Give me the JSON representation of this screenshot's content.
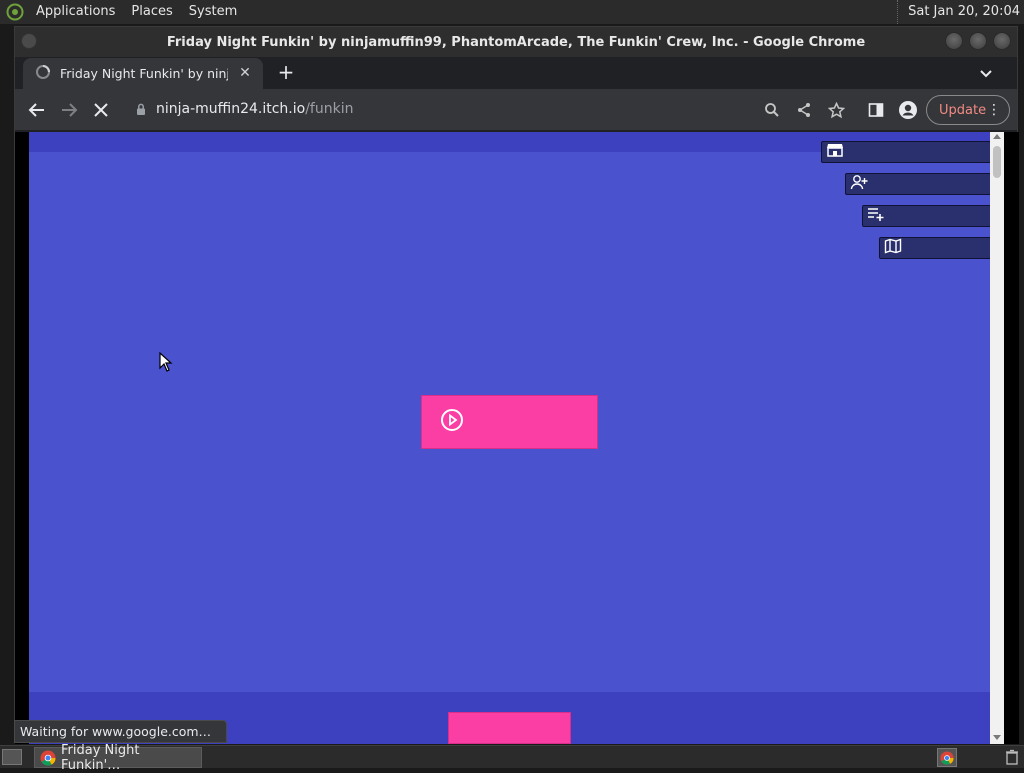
{
  "top_panel": {
    "menus": [
      "Applications",
      "Places",
      "System"
    ],
    "clock": "Sat Jan 20, 20:04"
  },
  "window": {
    "title": "Friday Night Funkin' by ninjamuffin99, PhantomArcade, The Funkin' Crew, Inc. - Google Chrome"
  },
  "tab": {
    "title": "Friday Night Funkin' by ninjamuffin99",
    "close_glyph": "✕"
  },
  "newtab_glyph": "+",
  "omnibox": {
    "host": "ninja-muffin24.itch.io",
    "path": "/funkin"
  },
  "toolbar": {
    "update_label": "Update",
    "menu_glyph": "⋮"
  },
  "page": {
    "side_buttons": [
      "store-icon",
      "follow-icon",
      "add-to-collection-icon",
      "devlog-icon"
    ],
    "play_icon": "play-circle-icon"
  },
  "status": {
    "text": "Waiting for www.google.com…"
  },
  "taskbar": {
    "task_label": "Friday Night Funkin'…"
  },
  "colors": {
    "page_bg": "#4a52cd",
    "page_band": "#3d41c0",
    "play_button": "#fa3ea4",
    "side_button": "#2a2f6e",
    "update_text": "#f28b82"
  }
}
